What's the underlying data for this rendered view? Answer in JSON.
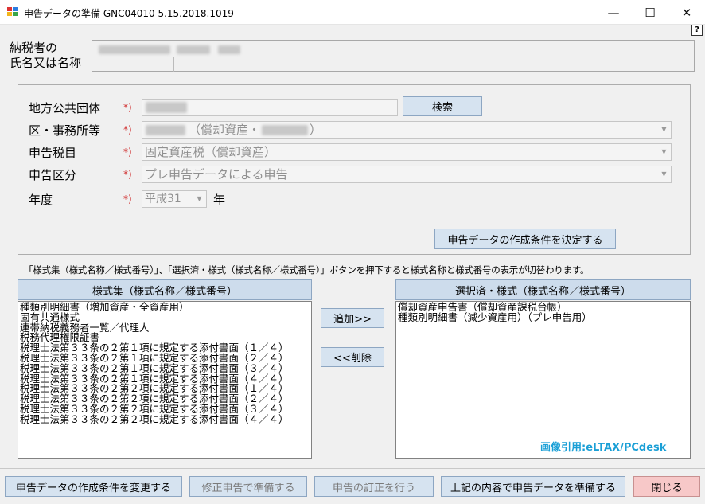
{
  "window": {
    "title": "申告データの準備 GNC04010  5.15.2018.1019",
    "minimize": "—",
    "maximize": "☐",
    "close": "✕"
  },
  "help": "?",
  "taxpayer": {
    "label_line1": "納税者の",
    "label_line2": "氏名又は名称"
  },
  "form": {
    "required_mark": "*)",
    "municipality": {
      "label": "地方公共団体"
    },
    "search_button": "検索",
    "office": {
      "label": "区・事務所等",
      "value_mid": "（償却資産・",
      "value_end": "）"
    },
    "tax_item": {
      "label": "申告税目",
      "value": "固定資産税（償却資産）"
    },
    "declaration_type": {
      "label": "申告区分",
      "value": "プレ申告データによる申告"
    },
    "year": {
      "label": "年度",
      "value": "平成31",
      "suffix": "年"
    },
    "decide_button": "申告データの作成条件を決定する"
  },
  "note": "「様式集（様式名称／様式番号）」、「選択済・様式（様式名称／様式番号）」ボタンを押下すると様式名称と様式番号の表示が切替わります。",
  "left_list": {
    "header": "様式集（様式名称／様式番号）",
    "items": [
      "種類別明細書（増加資産・全資産用）",
      "固有共通様式",
      "連帯納税義務者一覧／代理人",
      "税務代理権限証書",
      "税理士法第３３条の２第１項に規定する添付書面（１／４）",
      "税理士法第３３条の２第１項に規定する添付書面（２／４）",
      "税理士法第３３条の２第１項に規定する添付書面（３／４）",
      "税理士法第３３条の２第１項に規定する添付書面（４／４）",
      "税理士法第３３条の２第２項に規定する添付書面（１／４）",
      "税理士法第３３条の２第２項に規定する添付書面（２／４）",
      "税理士法第３３条の２第２項に規定する添付書面（３／４）",
      "税理士法第３３条の２第２項に規定する添付書面（４／４）"
    ]
  },
  "right_list": {
    "header": "選択済・様式（様式名称／様式番号）",
    "items": [
      "償却資産申告書（償却資産課税台帳）",
      "種類別明細書（減少資産用）（プレ申告用）"
    ]
  },
  "add_button": "追加>>",
  "delete_button": "<<削除",
  "watermark": "画像引用:eLTAX/PCdesk",
  "footer": {
    "change_conditions": "申告データの作成条件を変更する",
    "amend": "修正申告で準備する",
    "correct": "申告の訂正を行う",
    "prepare": "上記の内容で申告データを準備する",
    "close": "閉じる"
  }
}
